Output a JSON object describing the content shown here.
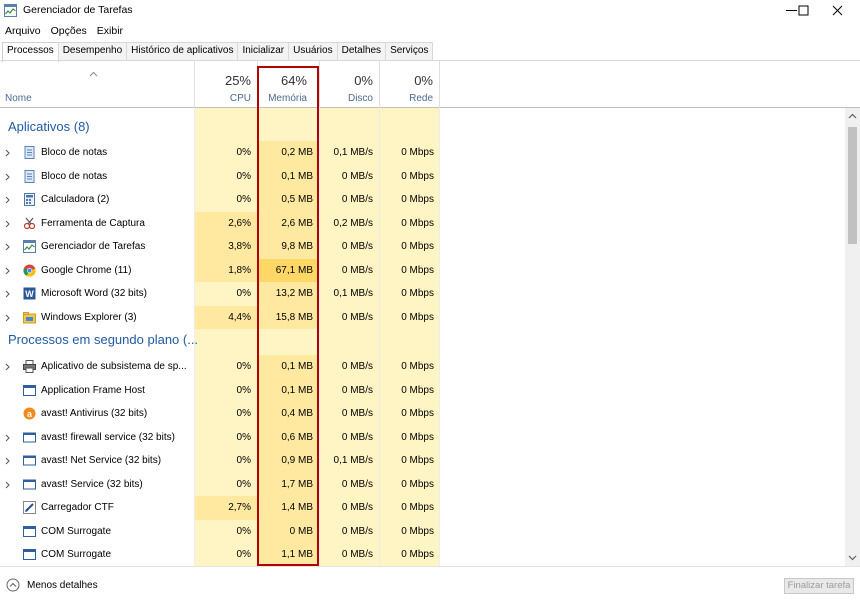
{
  "window": {
    "title": "Gerenciador de Tarefas",
    "minimize_icon": "minimize-icon",
    "maximize_icon": "maximize-icon",
    "close_icon": "close-icon"
  },
  "menu": [
    "Arquivo",
    "Opções",
    "Exibir"
  ],
  "tabs": [
    {
      "label": "Processos",
      "active": true
    },
    {
      "label": "Desempenho",
      "active": false
    },
    {
      "label": "Histórico de aplicativos",
      "active": false
    },
    {
      "label": "Inicializar",
      "active": false
    },
    {
      "label": "Usuários",
      "active": false
    },
    {
      "label": "Detalhes",
      "active": false
    },
    {
      "label": "Serviços",
      "active": false
    }
  ],
  "columns": {
    "name": "Nome",
    "cpu": {
      "pct": "25%",
      "label": "CPU"
    },
    "memory": {
      "pct": "64%",
      "label": "Memória"
    },
    "disk": {
      "pct": "0%",
      "label": "Disco"
    },
    "network": {
      "pct": "0%",
      "label": "Rede"
    }
  },
  "groups": [
    {
      "title": "Aplicativos (8)",
      "rows": [
        {
          "name": "Bloco de notas",
          "icon": "notepad-icon",
          "expand": true,
          "cpu": "0%",
          "mem": "0,2 MB",
          "disk": "0,1 MB/s",
          "net": "0 Mbps",
          "memLevel": 1
        },
        {
          "name": "Bloco de notas",
          "icon": "notepad-icon",
          "expand": true,
          "cpu": "0%",
          "mem": "0,1 MB",
          "disk": "0 MB/s",
          "net": "0 Mbps",
          "memLevel": 1
        },
        {
          "name": "Calculadora (2)",
          "icon": "calculator-icon",
          "expand": true,
          "cpu": "0%",
          "mem": "0,5 MB",
          "disk": "0 MB/s",
          "net": "0 Mbps",
          "memLevel": 1
        },
        {
          "name": "Ferramenta de Captura",
          "icon": "snipping-tool-icon",
          "expand": true,
          "cpu": "2,6%",
          "mem": "2,6 MB",
          "disk": "0,2 MB/s",
          "net": "0 Mbps",
          "memLevel": 1,
          "cpuLevel": 1
        },
        {
          "name": "Gerenciador de Tarefas",
          "icon": "task-manager-icon",
          "expand": true,
          "cpu": "3,8%",
          "mem": "9,8 MB",
          "disk": "0 MB/s",
          "net": "0 Mbps",
          "memLevel": 1,
          "cpuLevel": 1
        },
        {
          "name": "Google Chrome (11)",
          "icon": "chrome-icon",
          "expand": true,
          "cpu": "1,8%",
          "mem": "67,1 MB",
          "disk": "0 MB/s",
          "net": "0 Mbps",
          "memLevel": 2,
          "cpuLevel": 1
        },
        {
          "name": "Microsoft Word (32 bits)",
          "icon": "word-icon",
          "expand": true,
          "cpu": "0%",
          "mem": "13,2 MB",
          "disk": "0,1 MB/s",
          "net": "0 Mbps",
          "memLevel": 1
        },
        {
          "name": "Windows Explorer (3)",
          "icon": "explorer-icon",
          "expand": true,
          "cpu": "4,4%",
          "mem": "15,8 MB",
          "disk": "0 MB/s",
          "net": "0 Mbps",
          "memLevel": 1,
          "cpuLevel": 1
        }
      ]
    },
    {
      "title": "Processos em segundo plano (...",
      "rows": [
        {
          "name": "Aplicativo de subsistema de sp...",
          "icon": "printer-icon",
          "expand": true,
          "cpu": "0%",
          "mem": "0,1 MB",
          "disk": "0 MB/s",
          "net": "0 Mbps",
          "memLevel": 1
        },
        {
          "name": "Application Frame Host",
          "icon": "app-frame-icon",
          "expand": false,
          "cpu": "0%",
          "mem": "0,1 MB",
          "disk": "0 MB/s",
          "net": "0 Mbps",
          "memLevel": 1
        },
        {
          "name": "avast! Antivirus (32 bits)",
          "icon": "avast-icon",
          "expand": false,
          "cpu": "0%",
          "mem": "0,4 MB",
          "disk": "0 MB/s",
          "net": "0 Mbps",
          "memLevel": 1
        },
        {
          "name": "avast! firewall service (32 bits)",
          "icon": "service-icon",
          "expand": true,
          "cpu": "0%",
          "mem": "0,6 MB",
          "disk": "0 MB/s",
          "net": "0 Mbps",
          "memLevel": 1
        },
        {
          "name": "avast! Net Service (32 bits)",
          "icon": "service-icon",
          "expand": true,
          "cpu": "0%",
          "mem": "0,9 MB",
          "disk": "0,1 MB/s",
          "net": "0 Mbps",
          "memLevel": 1
        },
        {
          "name": "avast! Service (32 bits)",
          "icon": "service-icon",
          "expand": true,
          "cpu": "0%",
          "mem": "1,7 MB",
          "disk": "0 MB/s",
          "net": "0 Mbps",
          "memLevel": 1
        },
        {
          "name": "Carregador CTF",
          "icon": "ctf-icon",
          "expand": false,
          "cpu": "2,7%",
          "mem": "1,4 MB",
          "disk": "0 MB/s",
          "net": "0 Mbps",
          "memLevel": 1,
          "cpuLevel": 1
        },
        {
          "name": "COM Surrogate",
          "icon": "app-frame-icon",
          "expand": false,
          "cpu": "0%",
          "mem": "0 MB",
          "disk": "0 MB/s",
          "net": "0 Mbps",
          "memLevel": 1
        },
        {
          "name": "COM Surrogate",
          "icon": "app-frame-icon",
          "expand": false,
          "cpu": "0%",
          "mem": "1,1 MB",
          "disk": "0 MB/s",
          "net": "0 Mbps",
          "memLevel": 1
        }
      ]
    }
  ],
  "footer": {
    "less_details": "Menos detalhes",
    "end_task": "Finalizar tarefa"
  },
  "colors": {
    "heat_light": "#fff4c4",
    "heat_mid": "#ffe9a0",
    "heat_strong": "#ffd766",
    "highlight_border": "#b30000",
    "group_title": "#1f5aa6"
  }
}
